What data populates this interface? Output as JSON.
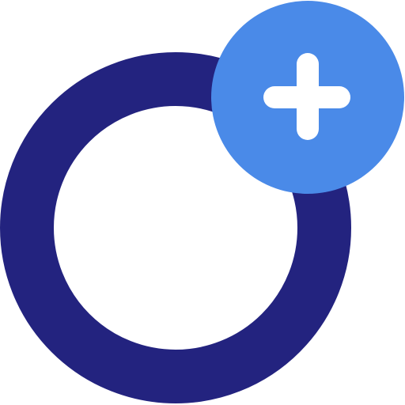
{
  "logo": {
    "name": "ring-with-plus-badge",
    "ring_color": "#23237F",
    "badge_color": "#4A8AE8",
    "plus_color": "#FFFFFF",
    "background": "#FFFFFF"
  }
}
